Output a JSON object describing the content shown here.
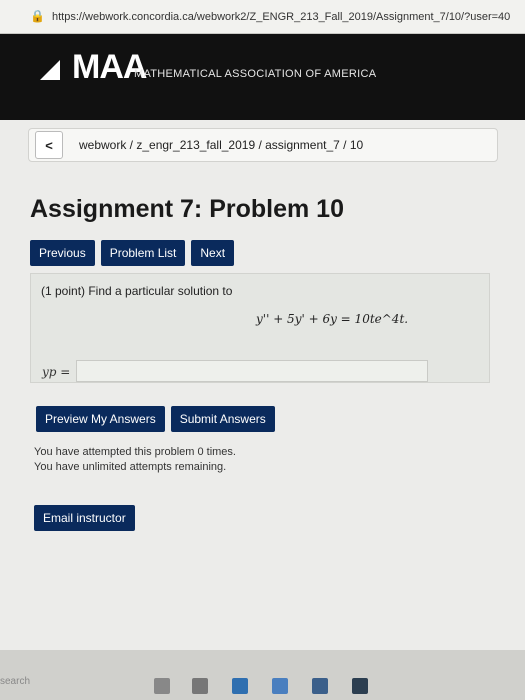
{
  "browser": {
    "url": "https://webwork.concordia.ca/webwork2/Z_ENGR_213_Fall_2019/Assignment_7/10/?user=40"
  },
  "header": {
    "brand": "MAA",
    "tagline": "MATHEMATICAL ASSOCIATION OF AMERICA"
  },
  "breadcrumb": {
    "back_label": "<",
    "path": "webwork / z_engr_213_fall_2019 / assignment_7 / 10"
  },
  "page": {
    "title": "Assignment 7: Problem 10"
  },
  "nav": {
    "previous": "Previous",
    "problem_list": "Problem List",
    "next": "Next"
  },
  "problem": {
    "intro": "(1 point) Find a particular solution to",
    "equation": "y'' + 5y' + 6y = 10te^4t.",
    "answer_label": "yp =",
    "answer_value": ""
  },
  "actions": {
    "preview": "Preview My Answers",
    "submit": "Submit Answers"
  },
  "attempts": {
    "line1": "You have attempted this problem 0 times.",
    "line2": "You have unlimited attempts remaining."
  },
  "email": {
    "label": "Email instructor"
  },
  "taskbar": {
    "search": "search"
  },
  "colors": {
    "button": "#0a2a5c",
    "header_bg": "#111111"
  }
}
